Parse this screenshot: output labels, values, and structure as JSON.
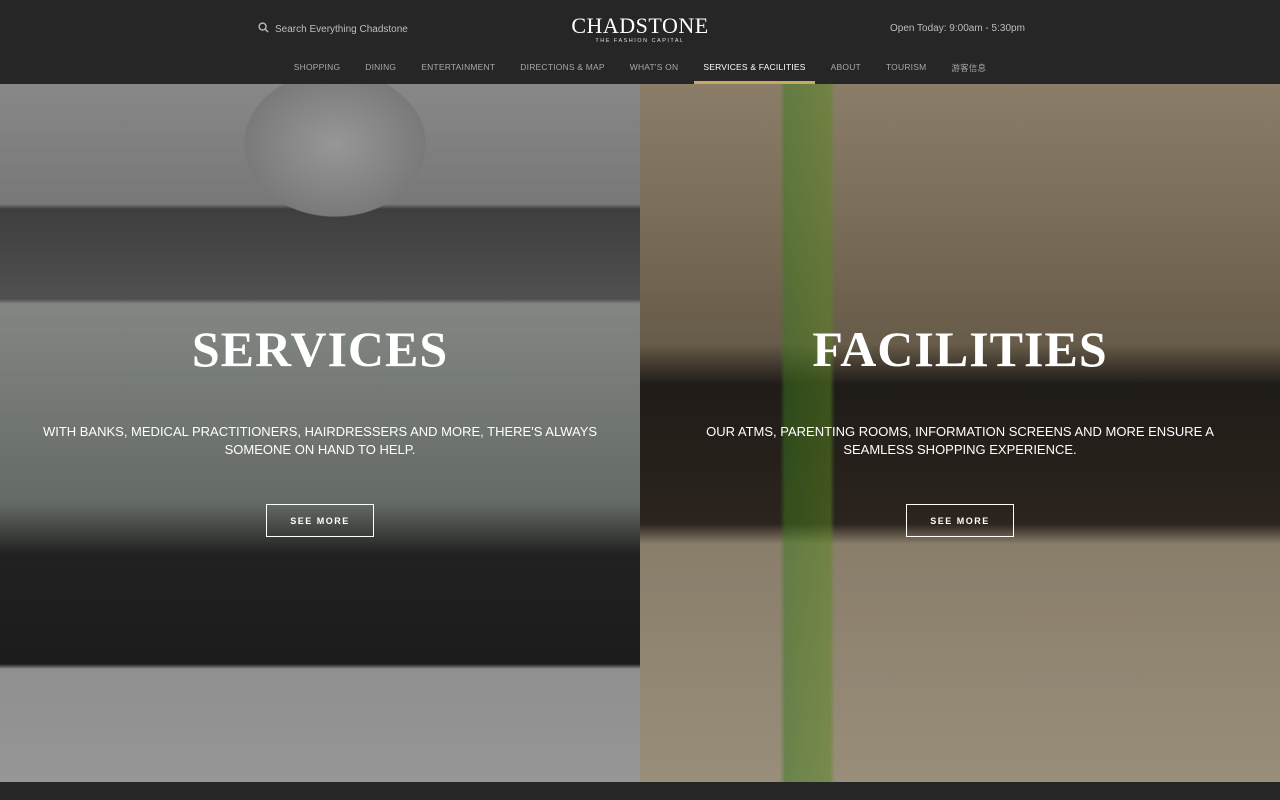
{
  "header": {
    "search_placeholder": "Search Everything Chadstone",
    "logo_name": "CHADSTONE",
    "logo_tagline": "THE FASHION CAPITAL",
    "hours": "Open Today: 9:00am - 5:30pm"
  },
  "nav": [
    {
      "label": "SHOPPING"
    },
    {
      "label": "DINING"
    },
    {
      "label": "ENTERTAINMENT"
    },
    {
      "label": "DIRECTIONS & MAP"
    },
    {
      "label": "WHAT'S ON"
    },
    {
      "label": "SERVICES & FACILITIES",
      "active": true
    },
    {
      "label": "ABOUT"
    },
    {
      "label": "TOURISM"
    },
    {
      "label": "游客信息"
    }
  ],
  "panels": {
    "services": {
      "title": "SERVICES",
      "description": "With banks, medical practitioners, hairdressers and more, there's always someone on hand to help.",
      "button": "SEE MORE"
    },
    "facilities": {
      "title": "FACILITIES",
      "description": "Our ATMs, parenting rooms, information screens and more ensure a seamless shopping experience.",
      "button": "SEE MORE"
    }
  },
  "colors": {
    "accent": "#c8a964",
    "header_bg": "#262626"
  }
}
